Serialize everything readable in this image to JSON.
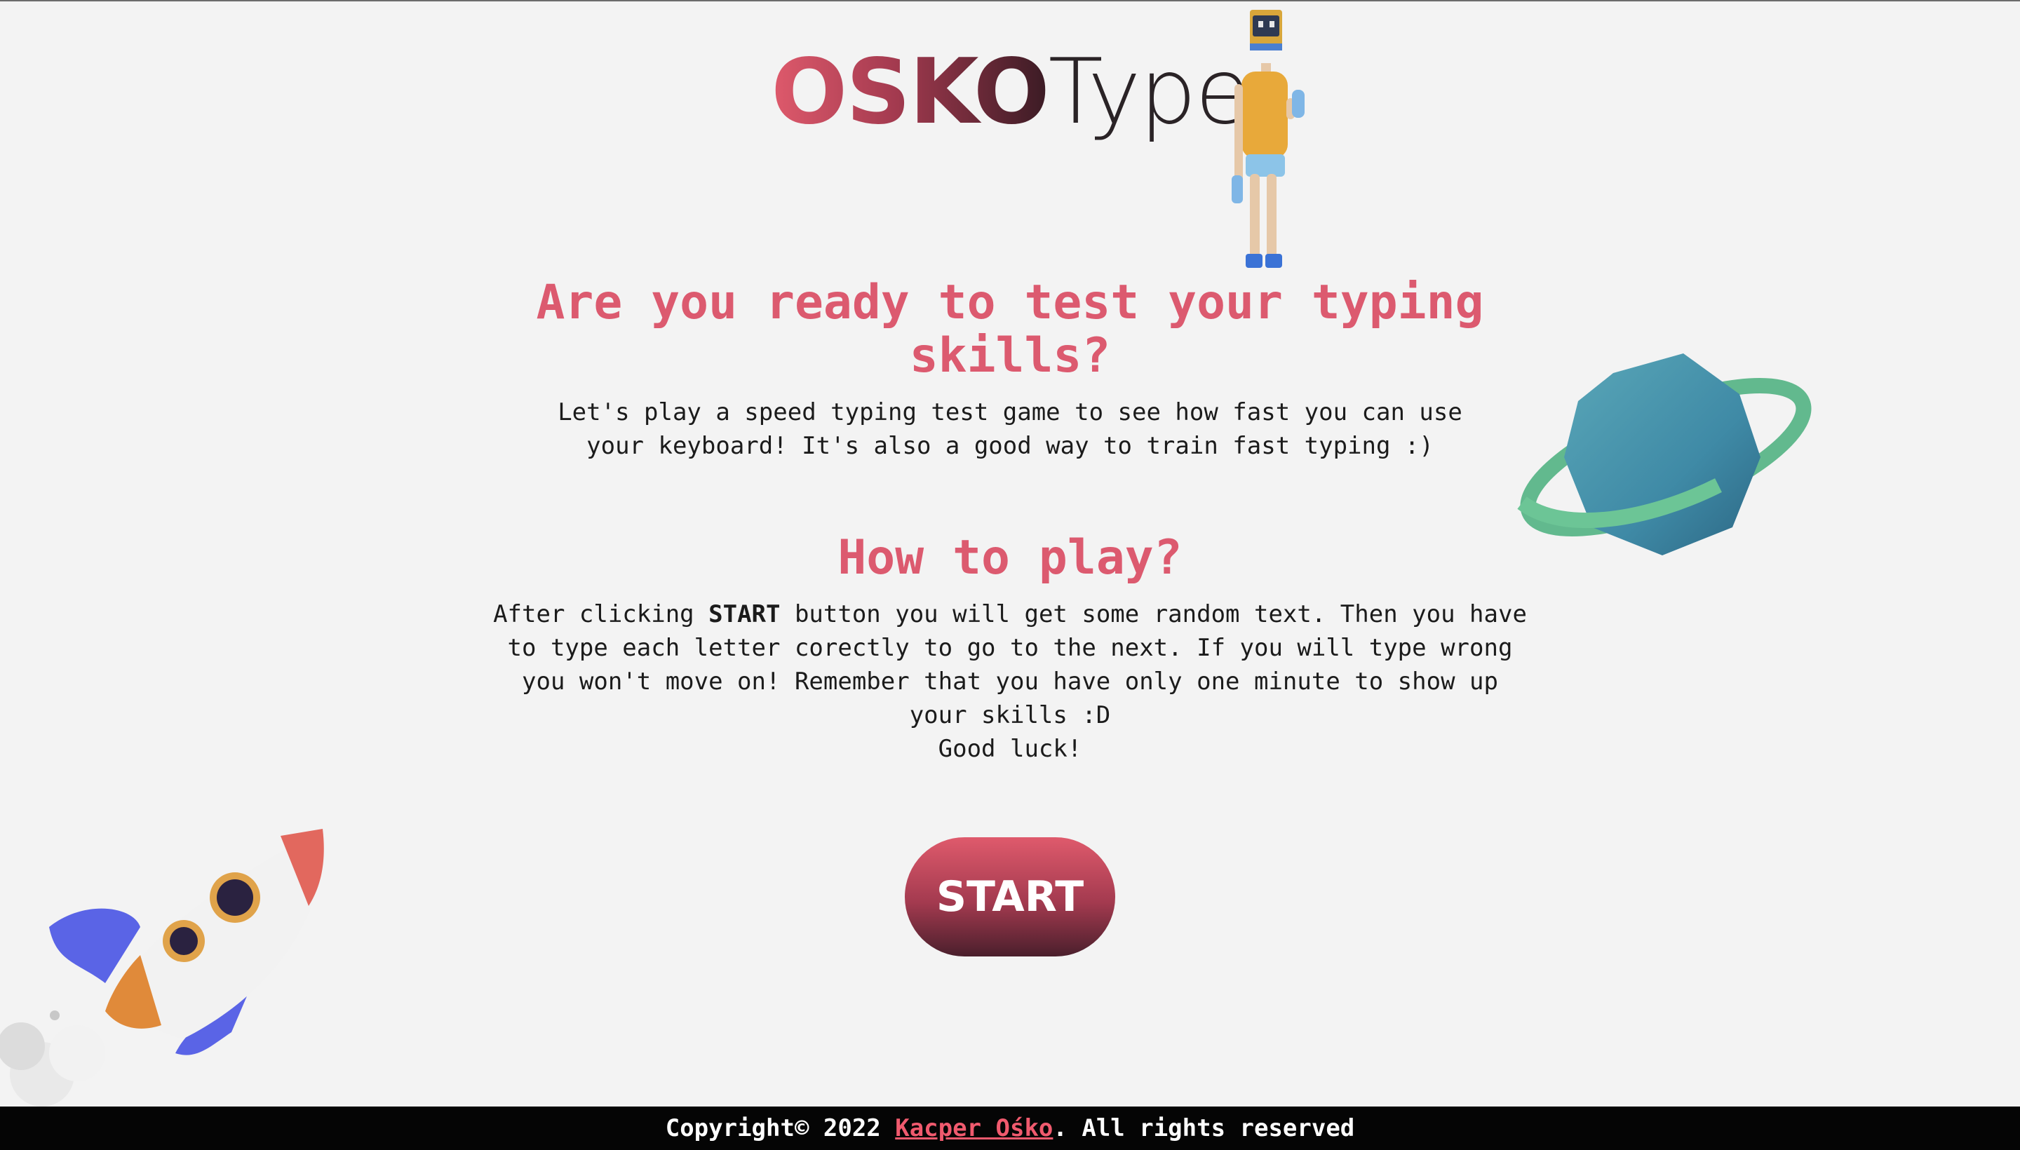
{
  "logo": {
    "bold_part": "OSKO",
    "light_part": "Type"
  },
  "intro": {
    "heading": "Are you ready to test your typing skills?",
    "text": "Let's play a speed typing test game to see how fast you can use your keyboard! It's also a good way to train fast typing :)"
  },
  "how_to": {
    "heading": "How to play?",
    "text_before": "After clicking ",
    "text_bold": "START",
    "text_after": " button you will get some random text. Then you have to type each letter corectly to go to the next. If you will type wrong you won't move on! Remember that you have only one minute to show up your skills :D",
    "good_luck": "Good luck!"
  },
  "start_button": {
    "label": "START"
  },
  "footer": {
    "prefix": "Copyright© 2022 ",
    "author_link": "Kacper Ośko",
    "suffix": ". All rights reserved"
  },
  "colors": {
    "accent": "#dc5a6f",
    "background": "#f3f3f3",
    "footer_bg": "#050505",
    "link": "#f05a6e"
  },
  "decorations": {
    "character": "waving-robot-head-character",
    "planet": "ringed-planet-icon",
    "rocket": "rocket-icon"
  }
}
